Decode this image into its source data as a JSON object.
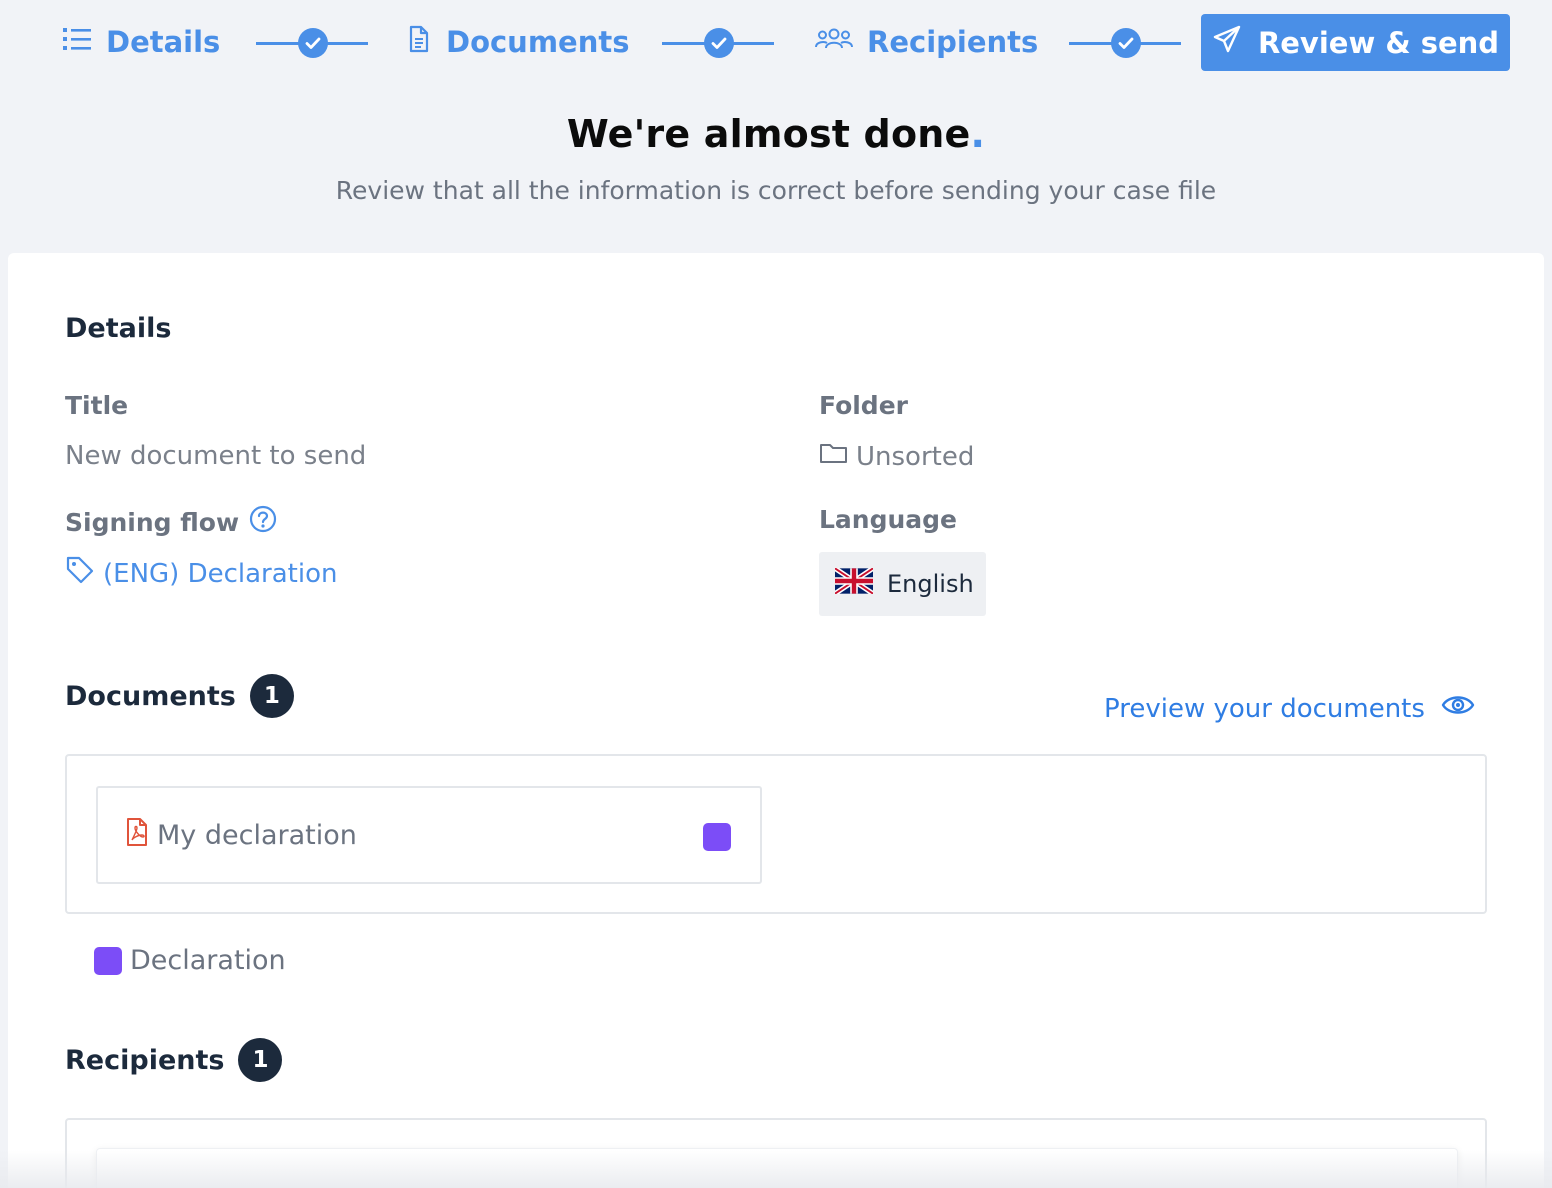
{
  "stepper": {
    "steps": [
      {
        "label": "Details",
        "icon": "list-icon",
        "state": "complete"
      },
      {
        "label": "Documents",
        "icon": "document-icon",
        "state": "complete"
      },
      {
        "label": "Recipients",
        "icon": "users-icon",
        "state": "complete"
      },
      {
        "label": "Review & send",
        "icon": "paper-plane-icon",
        "state": "active"
      }
    ],
    "connector_icon": "check-circle-icon"
  },
  "header": {
    "title": "We're almost done",
    "title_dot": ".",
    "subtitle": "Review that all the information is correct before sending your case file"
  },
  "details": {
    "section_title": "Details",
    "title_label": "Title",
    "title_value": "New document to send",
    "folder_label": "Folder",
    "folder_value": "Unsorted",
    "signing_flow_label": "Signing flow",
    "signing_flow_value": "(ENG) Declaration",
    "language_label": "Language",
    "language_value": "English"
  },
  "documents": {
    "section_title": "Documents",
    "count": "1",
    "preview_link": "Preview your documents",
    "items": [
      {
        "name": "My declaration",
        "type_icon": "pdf-icon",
        "color": "#7c4df7"
      }
    ],
    "legend": [
      {
        "label": "Declaration",
        "color": "#7c4df7"
      }
    ]
  },
  "recipients": {
    "section_title": "Recipients",
    "count": "1"
  },
  "colors": {
    "accent": "#4a8fe7",
    "dark": "#1c2a3c",
    "document_type": "#7c4df7",
    "page_bg": "#f1f3f7"
  }
}
